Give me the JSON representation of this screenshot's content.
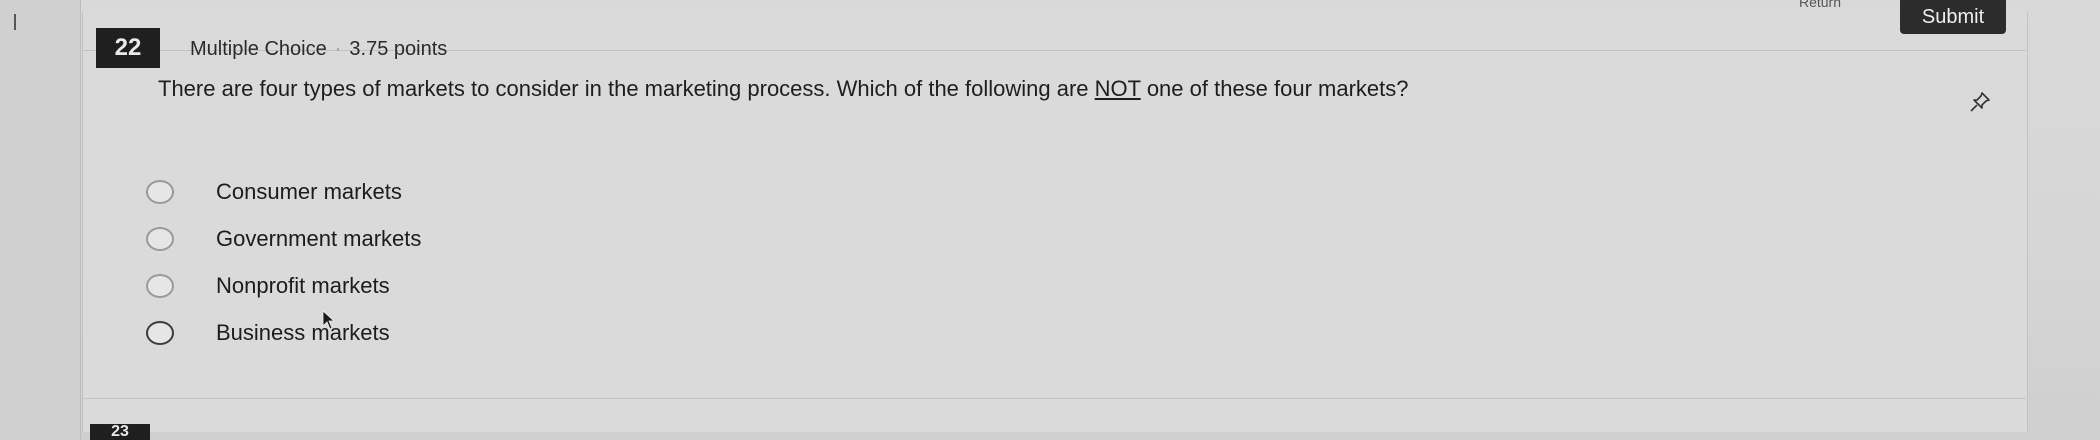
{
  "header": {
    "return_label": "Return",
    "submit_label": "Submit"
  },
  "question": {
    "number": "22",
    "type": "Multiple Choice",
    "separator": "·",
    "points": "3.75 points",
    "prompt_before": "There are four types of markets to consider in the marketing process. Which of the following are ",
    "prompt_emphasis": "NOT",
    "prompt_after": " one of these four markets?",
    "options": [
      {
        "label": "Consumer markets",
        "selected": false
      },
      {
        "label": "Government markets",
        "selected": false
      },
      {
        "label": "Nonprofit markets",
        "selected": false
      },
      {
        "label": "Business markets",
        "selected": false
      }
    ]
  },
  "next_question": {
    "number": "23"
  },
  "icons": {
    "pin": "pin-icon",
    "radio": "radio-icon",
    "cursor": "mouse-cursor-icon"
  },
  "colors": {
    "badge_bg": "#1f1f1f",
    "submit_bg": "#2c2c2c",
    "page_bg": "#d9d9d9"
  }
}
